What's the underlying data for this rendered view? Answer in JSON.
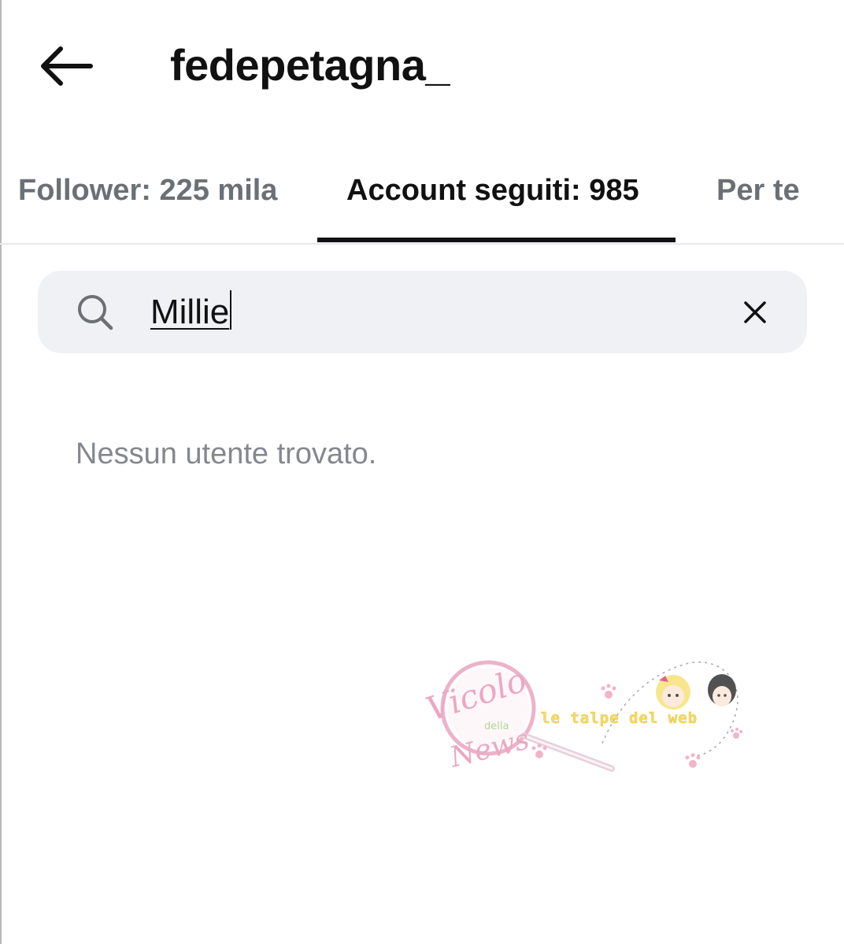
{
  "header": {
    "back_icon": "arrow-left-icon",
    "title": "fedepetagna_"
  },
  "tabs": [
    {
      "label": "Follower: 225 mila",
      "active": false
    },
    {
      "label": "Account seguiti: 985",
      "active": true
    },
    {
      "label": "Per te",
      "active": false
    }
  ],
  "search": {
    "icon": "search-icon",
    "value": "Millie",
    "clear_icon": "close-icon"
  },
  "results": {
    "empty_message": "Nessun utente trovato."
  },
  "watermark": {
    "line1": "Vicolo",
    "line2": "della",
    "line3": "News",
    "tagline": "le talpe del web"
  },
  "colors": {
    "text_primary": "#111111",
    "text_secondary": "#6b7076",
    "empty_text": "#84888e",
    "search_bg": "#eff1f4",
    "tab_indicator": "#111111",
    "watermark_pink": "#e89ab8",
    "watermark_yellow": "#f3d54a"
  }
}
